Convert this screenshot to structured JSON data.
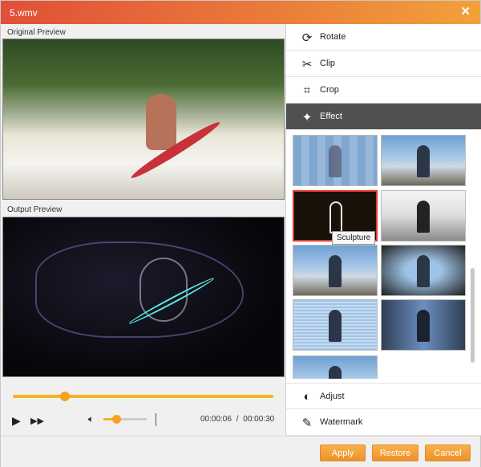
{
  "window": {
    "title": "5.wmv",
    "close_label": "✕"
  },
  "preview": {
    "original_label": "Original Preview",
    "output_label": "Output Preview"
  },
  "playback": {
    "progress": 0.2,
    "volume": 0.3,
    "current_time": "00:00:06",
    "total_time": "00:00:30",
    "time_separator": "/",
    "accent_color": "#f6b21f"
  },
  "menu": {
    "items": [
      {
        "label": "Rotate",
        "icon": "rotate-icon"
      },
      {
        "label": "Clip",
        "icon": "scissors-icon"
      },
      {
        "label": "Crop",
        "icon": "crop-icon"
      },
      {
        "label": "Effect",
        "icon": "effect-stars-icon",
        "active": true
      }
    ],
    "bottom_items": [
      {
        "label": "Adjust",
        "icon": "adjust-icon"
      },
      {
        "label": "Watermark",
        "icon": "brush-icon"
      }
    ]
  },
  "effects": {
    "tooltip": "Sculpture",
    "selected_index": 2,
    "selected_color": "#e53a2a"
  },
  "actions": {
    "apply": "Apply",
    "restore": "Restore",
    "cancel": "Cancel",
    "button_color": "#f0a030"
  },
  "colors": {
    "title_gradient_start": "#e14f38",
    "title_gradient_end": "#f2a13a",
    "active_menu_bg": "#505050"
  }
}
